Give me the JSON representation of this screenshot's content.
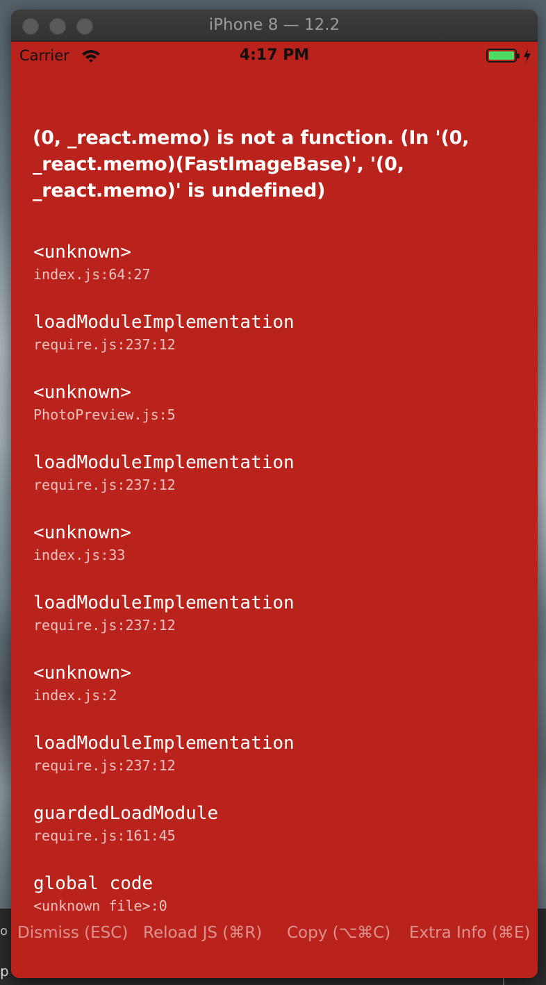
{
  "window": {
    "title": "iPhone 8 — 12.2"
  },
  "status_bar": {
    "carrier": "Carrier",
    "time": "4:17 PM",
    "battery_color": "#4cd964"
  },
  "error": {
    "message": "(0, _react.memo) is not a function. (In '(0, _react.memo)(FastImageBase)', '(0, _react.memo)' is undefined)",
    "background": "#b9231c"
  },
  "stack_frames": [
    {
      "method": "<unknown>",
      "file": "index.js:64:27"
    },
    {
      "method": "loadModuleImplementation",
      "file": "require.js:237:12"
    },
    {
      "method": "<unknown>",
      "file": "PhotoPreview.js:5"
    },
    {
      "method": "loadModuleImplementation",
      "file": "require.js:237:12"
    },
    {
      "method": "<unknown>",
      "file": "index.js:33"
    },
    {
      "method": "loadModuleImplementation",
      "file": "require.js:237:12"
    },
    {
      "method": "<unknown>",
      "file": "index.js:2"
    },
    {
      "method": "loadModuleImplementation",
      "file": "require.js:237:12"
    },
    {
      "method": "guardedLoadModule",
      "file": "require.js:161:45"
    },
    {
      "method": "global code",
      "file": "<unknown file>:0"
    }
  ],
  "actions": {
    "dismiss": "Dismiss (ESC)",
    "reload": "Reload JS (⌘R)",
    "copy": "Copy (⌥⌘C)",
    "extra_info": "Extra Info (⌘E)"
  },
  "background_fragments": {
    "left_letter_top": "o",
    "left_letter_bottom": "p"
  }
}
